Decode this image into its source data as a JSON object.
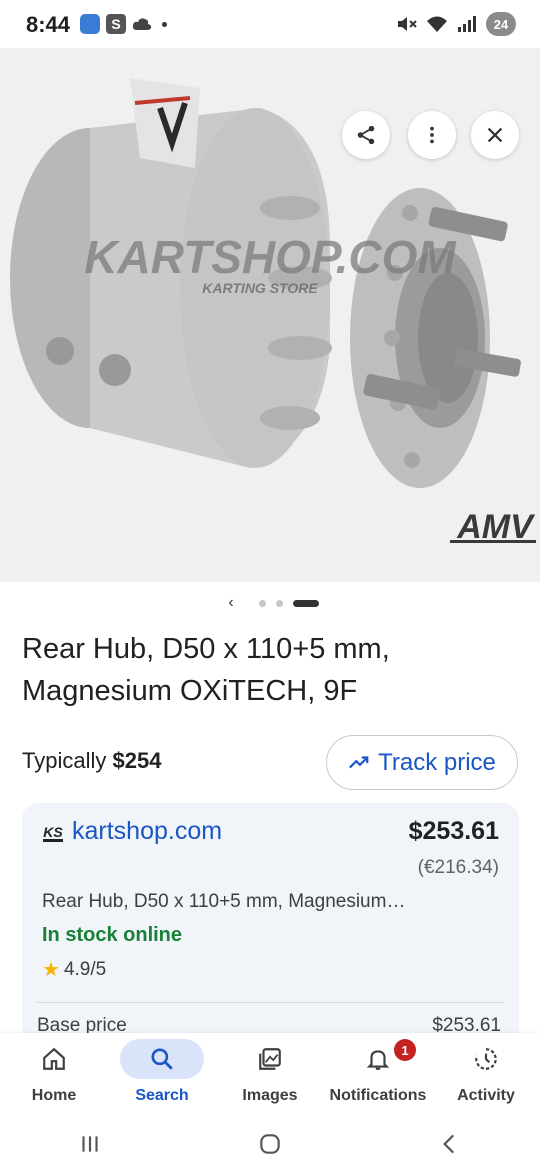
{
  "status_bar": {
    "time": "8:44",
    "s_badge": "S",
    "battery": "24"
  },
  "image_viewer": {
    "watermark_text": "KARTSHOP.COM",
    "watermark_sub": "KARTING STORE",
    "brand_mark": "AMV",
    "carousel_count": 3,
    "carousel_active_index": 2
  },
  "product": {
    "title": "Rear Hub, D50 x 110+5 mm, Magnesium OXiTECH, 9F",
    "typical_label": "Typically",
    "typical_price": "$254",
    "track_label": "Track price"
  },
  "merchant": {
    "logo_text": "KS",
    "name": "kartshop.com",
    "price": "$253.61",
    "price_eur": "(€216.34)",
    "description": "Rear Hub, D50 x 110+5 mm, Magnesium…",
    "stock": "In stock online",
    "rating": "4.9/5",
    "base_label": "Base price",
    "base_value": "$253.61"
  },
  "bottom_nav": {
    "items": [
      {
        "label": "Home",
        "icon": "home-icon"
      },
      {
        "label": "Search",
        "icon": "search-icon"
      },
      {
        "label": "Images",
        "icon": "images-icon"
      },
      {
        "label": "Notifications",
        "icon": "bell-icon",
        "badge": "1"
      },
      {
        "label": "Activity",
        "icon": "history-icon"
      }
    ],
    "active": "Search"
  },
  "colors": {
    "accent": "#1a56c4",
    "stock_green": "#188038",
    "badge_red": "#c5221f",
    "star": "#f4b400"
  }
}
